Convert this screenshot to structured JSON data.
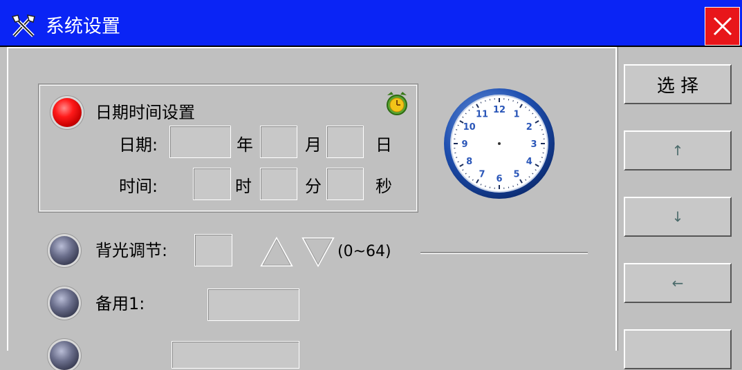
{
  "window": {
    "title": "系统设置",
    "close_icon": "close-icon"
  },
  "datetime_group": {
    "heading": "日期时间设置",
    "date_label": "日期:",
    "year_unit": "年",
    "month_unit": "月",
    "day_unit": "日",
    "time_label": "时间:",
    "hour_unit": "时",
    "minute_unit": "分",
    "second_unit": "秒",
    "alarm_icon": "alarm-clock-icon",
    "led_color": "#ff1a1a"
  },
  "clock": {
    "numbers": [
      "12",
      "1",
      "2",
      "3",
      "4",
      "5",
      "6",
      "7",
      "8",
      "9",
      "10",
      "11"
    ]
  },
  "backlight": {
    "label": "背光调节:",
    "range": "(0~64)",
    "up_icon": "triangle-up-icon",
    "down_icon": "triangle-down-icon"
  },
  "spare1": {
    "label": "备用1:"
  },
  "side_buttons": {
    "select_label": "选 择",
    "up_label": "↑",
    "down_label": "↓",
    "left_label": "←"
  },
  "colors": {
    "titlebar": "#0a24f5",
    "close": "#e8161a",
    "background": "#c0c0c0"
  }
}
